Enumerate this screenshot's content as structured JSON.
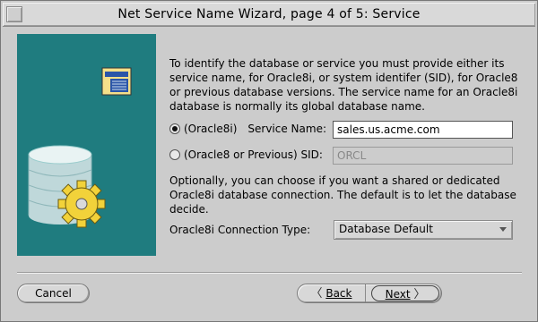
{
  "window": {
    "title": "Net Service Name Wizard, page 4 of 5: Service"
  },
  "intro_text": "To identify the database or service you must provide either its service name, for Oracle8i, or system identifer (SID), for Oracle8 or previous database versions. The service name for an Oracle8i database is normally its global database name.",
  "options": {
    "service_name_radio_label": "(Oracle8i)",
    "service_name_label": "Service Name:",
    "service_name_value": "sales.us.acme.com",
    "sid_radio_label": "(Oracle8 or Previous) SID:",
    "sid_value": "ORCL",
    "selected": "service_name"
  },
  "optional_text": "Optionally, you can choose if you want a shared or dedicated Oracle8i database connection. The default is to let the database decide.",
  "connection_type": {
    "label": "Oracle8i Connection Type:",
    "selected": "Database Default"
  },
  "buttons": {
    "cancel": "Cancel",
    "back": "Back",
    "next": "Next"
  }
}
